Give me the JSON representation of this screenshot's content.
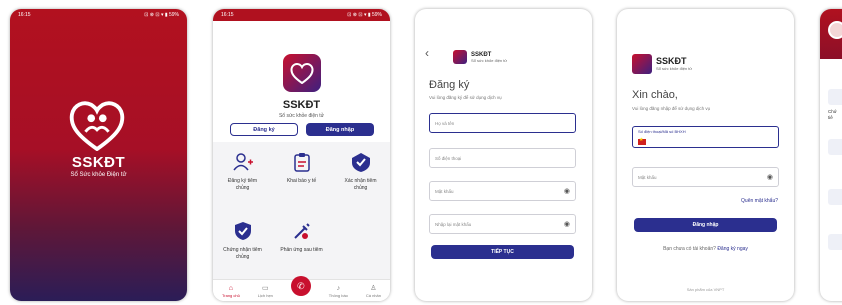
{
  "status_time": "16:15",
  "status_right": "⊡ ⊗ ⊡ ▾ ▮ 59%",
  "splash": {
    "brand": "SSKĐT",
    "tagline": "Sổ Sức khỏe Điện tử"
  },
  "home": {
    "title": "SSKĐT",
    "subtitle": "Sổ sức khỏe điện tử",
    "register_button": "Đăng ký",
    "login_button": "Đăng nhập",
    "tiles": [
      {
        "label": "Đăng ký tiêm chủng",
        "icon": "user-add-icon"
      },
      {
        "label": "Khai báo y tế",
        "icon": "clipboard-icon"
      },
      {
        "label": "Xác nhận tiêm chủng",
        "icon": "syringe-check-icon"
      },
      {
        "label": "Chứng nhận tiêm chủng",
        "icon": "shield-check-icon"
      },
      {
        "label": "Phản ứng sau tiêm",
        "icon": "syringe-reaction-icon"
      }
    ],
    "nav": [
      {
        "label": "Trang chủ",
        "icon": "home-icon"
      },
      {
        "label": "Lịch hẹn",
        "icon": "calendar-icon"
      },
      {
        "label": "",
        "icon": "phone-icon"
      },
      {
        "label": "Thông báo",
        "icon": "bell-icon"
      },
      {
        "label": "Cá nhân",
        "icon": "user-icon"
      }
    ]
  },
  "register": {
    "app_name": "SSKĐT",
    "app_sub": "Sổ sức khỏe điện tử",
    "heading": "Đăng ký",
    "hint": "Vui lòng đăng ký để sử dụng dịch vụ",
    "fullname_placeholder": "Họ và tên",
    "phone_placeholder": "Số điện thoại",
    "password_placeholder": "Mật khẩu",
    "confirm_placeholder": "Nhập lại mật khẩu",
    "continue_button": "TIẾP TỤC"
  },
  "login": {
    "app_name": "SSKĐT",
    "app_sub": "Sổ sức khỏe điện tử",
    "heading": "Xin chào,",
    "hint": "Vui lòng đăng nhập để sử dụng dịch vụ",
    "phone_label": "Số điện thoại/Mã số BHXH",
    "password_placeholder": "Mật khẩu",
    "forgot_link": "Quên mật khẩu?",
    "login_button": "Đăng nhập",
    "no_account_text": "Bạn chưa có tài khoản?",
    "register_link": "Đăng ký ngay",
    "footer": "Sản phẩm của VNPT"
  },
  "partial": {
    "labels": [
      "Chứ",
      "tiê"
    ]
  }
}
